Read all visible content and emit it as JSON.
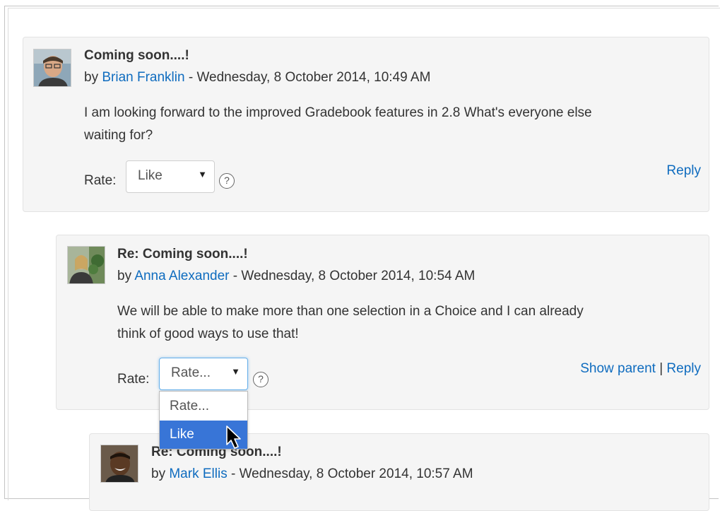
{
  "posts": [
    {
      "subject": "Coming soon....!",
      "by": "by ",
      "author": "Brian Franklin",
      "date": " - Wednesday, 8 October 2014, 10:49 AM",
      "message_line1": "I am looking forward to the improved Gradebook features in 2.8 What's everyone else",
      "message_line2": "waiting for?",
      "rate_label": "Rate:",
      "rate_value": "Like",
      "reply": "Reply"
    },
    {
      "subject": "Re: Coming soon....!",
      "by": "by ",
      "author": "Anna Alexander",
      "date": " - Wednesday, 8 October 2014, 10:54 AM",
      "message_line1": "We will be able to make more than one selection in a Choice and I can already",
      "message_line2": "think of good ways to use that!",
      "rate_label": "Rate:",
      "rate_value": "Rate...",
      "show_parent": "Show parent",
      "separator": " | ",
      "reply": "Reply"
    },
    {
      "subject": "Re: Coming soon....!",
      "by": "by ",
      "author": "Mark Ellis",
      "date": " - Wednesday, 8 October 2014, 10:57 AM"
    }
  ],
  "dropdown": {
    "options": [
      "Rate...",
      "Like"
    ],
    "highlighted": "Like"
  },
  "colors": {
    "link": "#0f6cbf",
    "highlight": "#3875d7",
    "post_bg": "#f5f5f5"
  },
  "icons": {
    "help": "question-circle-icon",
    "cursor": "mouse-pointer-icon",
    "select_arrow": "caret-down-icon"
  }
}
